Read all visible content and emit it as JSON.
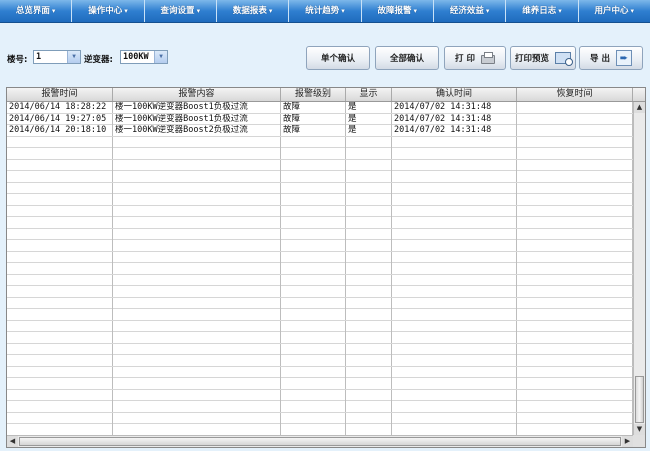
{
  "menu": {
    "items": [
      {
        "label": "总览界面",
        "arrow": "▾"
      },
      {
        "label": "操作中心",
        "arrow": "▾"
      },
      {
        "label": "查询设置",
        "arrow": "▾"
      },
      {
        "label": "数据报表",
        "arrow": "▾"
      },
      {
        "label": "统计趋势",
        "arrow": "▾"
      },
      {
        "label": "故障报警",
        "arrow": "▾"
      },
      {
        "label": "经济效益",
        "arrow": "▾"
      },
      {
        "label": "维养日志",
        "arrow": "▾"
      },
      {
        "label": "用户中心",
        "arrow": "▾"
      }
    ]
  },
  "toolbar": {
    "building_label": "楼号:",
    "building_value": "1",
    "inverter_label": "逆变器:",
    "inverter_value": "100KW",
    "confirm_single": "单个确认",
    "confirm_all": "全部确认",
    "print": "打  印",
    "print_preview": "打印预览",
    "export": "导  出"
  },
  "table": {
    "columns": [
      "报警时间",
      "报警内容",
      "报警级别",
      "显示",
      "确认时间",
      "恢复时间"
    ],
    "rows": [
      [
        "2014/06/14 18:28:22",
        "楼一100KW逆变器Boost1负极过流",
        "故障",
        "是",
        "2014/07/02 14:31:48",
        ""
      ],
      [
        "2014/06/14 19:27:05",
        "楼一100KW逆变器Boost1负极过流",
        "故障",
        "是",
        "2014/07/02 14:31:48",
        ""
      ],
      [
        "2014/06/14 20:18:10",
        "楼一100KW逆变器Boost2负极过流",
        "故障",
        "是",
        "2014/07/02 14:31:48",
        ""
      ]
    ]
  },
  "colors": {
    "menu_bg": "#2f7fd0",
    "page_bg": "#e4f1fb"
  }
}
